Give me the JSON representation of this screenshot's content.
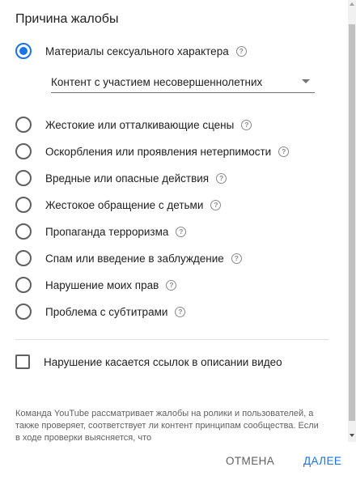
{
  "dialog": {
    "title": "Причина жалобы"
  },
  "reasons": [
    {
      "label": "Материалы сексуального характера",
      "checked": true
    },
    {
      "label": "Жестокие или отталкивающие сцены",
      "checked": false
    },
    {
      "label": "Оскорбления или проявления нетерпимости",
      "checked": false
    },
    {
      "label": "Вредные или опасные действия",
      "checked": false
    },
    {
      "label": "Жестокое обращение с детьми",
      "checked": false
    },
    {
      "label": "Пропаганда терроризма",
      "checked": false
    },
    {
      "label": "Спам или введение в заблуждение",
      "checked": false
    },
    {
      "label": "Нарушение моих прав",
      "checked": false
    },
    {
      "label": "Проблема с субтитрами",
      "checked": false
    }
  ],
  "subreason_select": {
    "value": "Контент с участием несовершеннолетних"
  },
  "links_checkbox": {
    "label": "Нарушение касается ссылок в описании видео",
    "checked": false
  },
  "note": {
    "text": "Команда YouTube рассматривает жалобы на ролики и пользователей, а также проверяет, соответствует ли контент принципам сообщества. Если в ходе проверки выясняется, что"
  },
  "footer": {
    "cancel_label": "ОТМЕНА",
    "next_label": "ДАЛЕЕ"
  },
  "icons": {
    "help": "help-circle-icon",
    "dropdown": "dropdown-arrow-icon"
  },
  "colors": {
    "accent": "#1a73e8",
    "text": "#212121",
    "secondary_text": "#606060"
  }
}
